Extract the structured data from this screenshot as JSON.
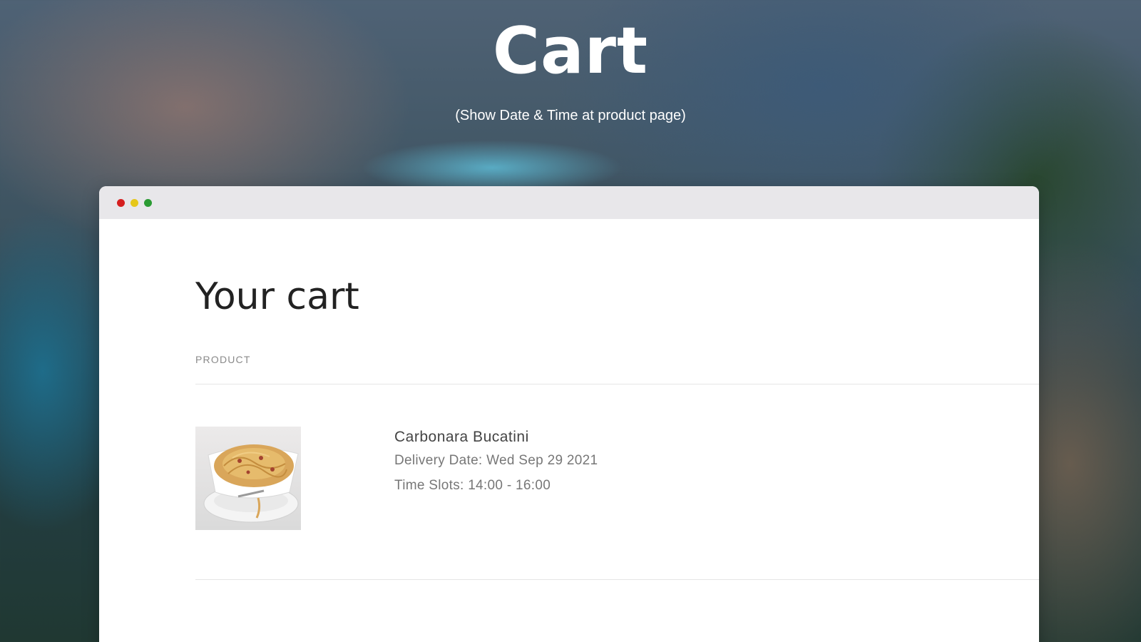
{
  "hero": {
    "title": "Cart",
    "subtitle": "(Show Date & Time at product page)"
  },
  "window": {
    "controls": [
      "close",
      "minimize",
      "maximize"
    ],
    "control_colors": {
      "close": "#d51f1f",
      "minimize": "#e6c719",
      "maximize": "#2b9b33"
    }
  },
  "cart": {
    "heading": "Your cart",
    "column_header": "PRODUCT",
    "items": [
      {
        "name": "Carbonara Bucatini",
        "delivery_date": "Delivery Date: Wed Sep 29 2021",
        "time_slots": "Time Slots: 14:00 - 16:00",
        "image_icon": "pasta-dish-image"
      }
    ]
  }
}
